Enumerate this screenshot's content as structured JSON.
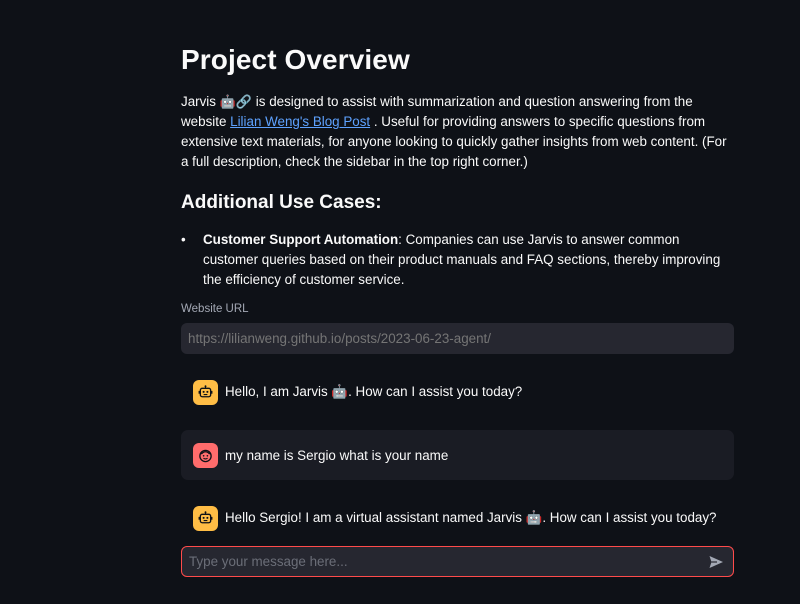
{
  "page": {
    "title": "Project Overview",
    "intro": {
      "before_link": "Jarvis ",
      "emoji": "🤖🔗",
      "after_emoji": " is designed to assist with summarization and question answering from the website ",
      "link_text": "Lilian Weng's Blog Post",
      "after_link": " . Useful for providing answers to specific questions from extensive text materials, for anyone looking to quickly gather insights from web content. (For a full description, check the sidebar in the top right corner.)"
    },
    "subheading": "Additional Use Cases:",
    "use_cases": [
      {
        "title": "Customer Support Automation",
        "text": ": Companies can use Jarvis to answer common customer queries based on their product manuals and FAQ sections, thereby improving the efficiency of customer service."
      }
    ]
  },
  "url_field": {
    "label": "Website URL",
    "placeholder": "https://lilianweng.github.io/posts/2023-06-23-agent/"
  },
  "chat": {
    "messages": [
      {
        "role": "assistant",
        "avatar_icon": "robot-icon",
        "text": "Hello, I am Jarvis 🤖. How can I assist you today?"
      },
      {
        "role": "user",
        "avatar_icon": "smiley-face-icon",
        "text": "my name is Sergio what is your name"
      },
      {
        "role": "assistant",
        "avatar_icon": "robot-icon",
        "text": "Hello Sergio! I am a virtual assistant named Jarvis 🤖. How can I assist you today?"
      }
    ],
    "input_placeholder": "Type your message here...",
    "send_icon": "send-icon"
  },
  "colors": {
    "background": "#0e1117",
    "text": "#fafafa",
    "link": "#5ea2ff",
    "input_bg": "#262730",
    "user_bubble_bg": "#1a1c24",
    "bot_avatar": "#ffbd45",
    "user_avatar": "#ff6c6c",
    "focus_border": "#ff4b4b"
  }
}
